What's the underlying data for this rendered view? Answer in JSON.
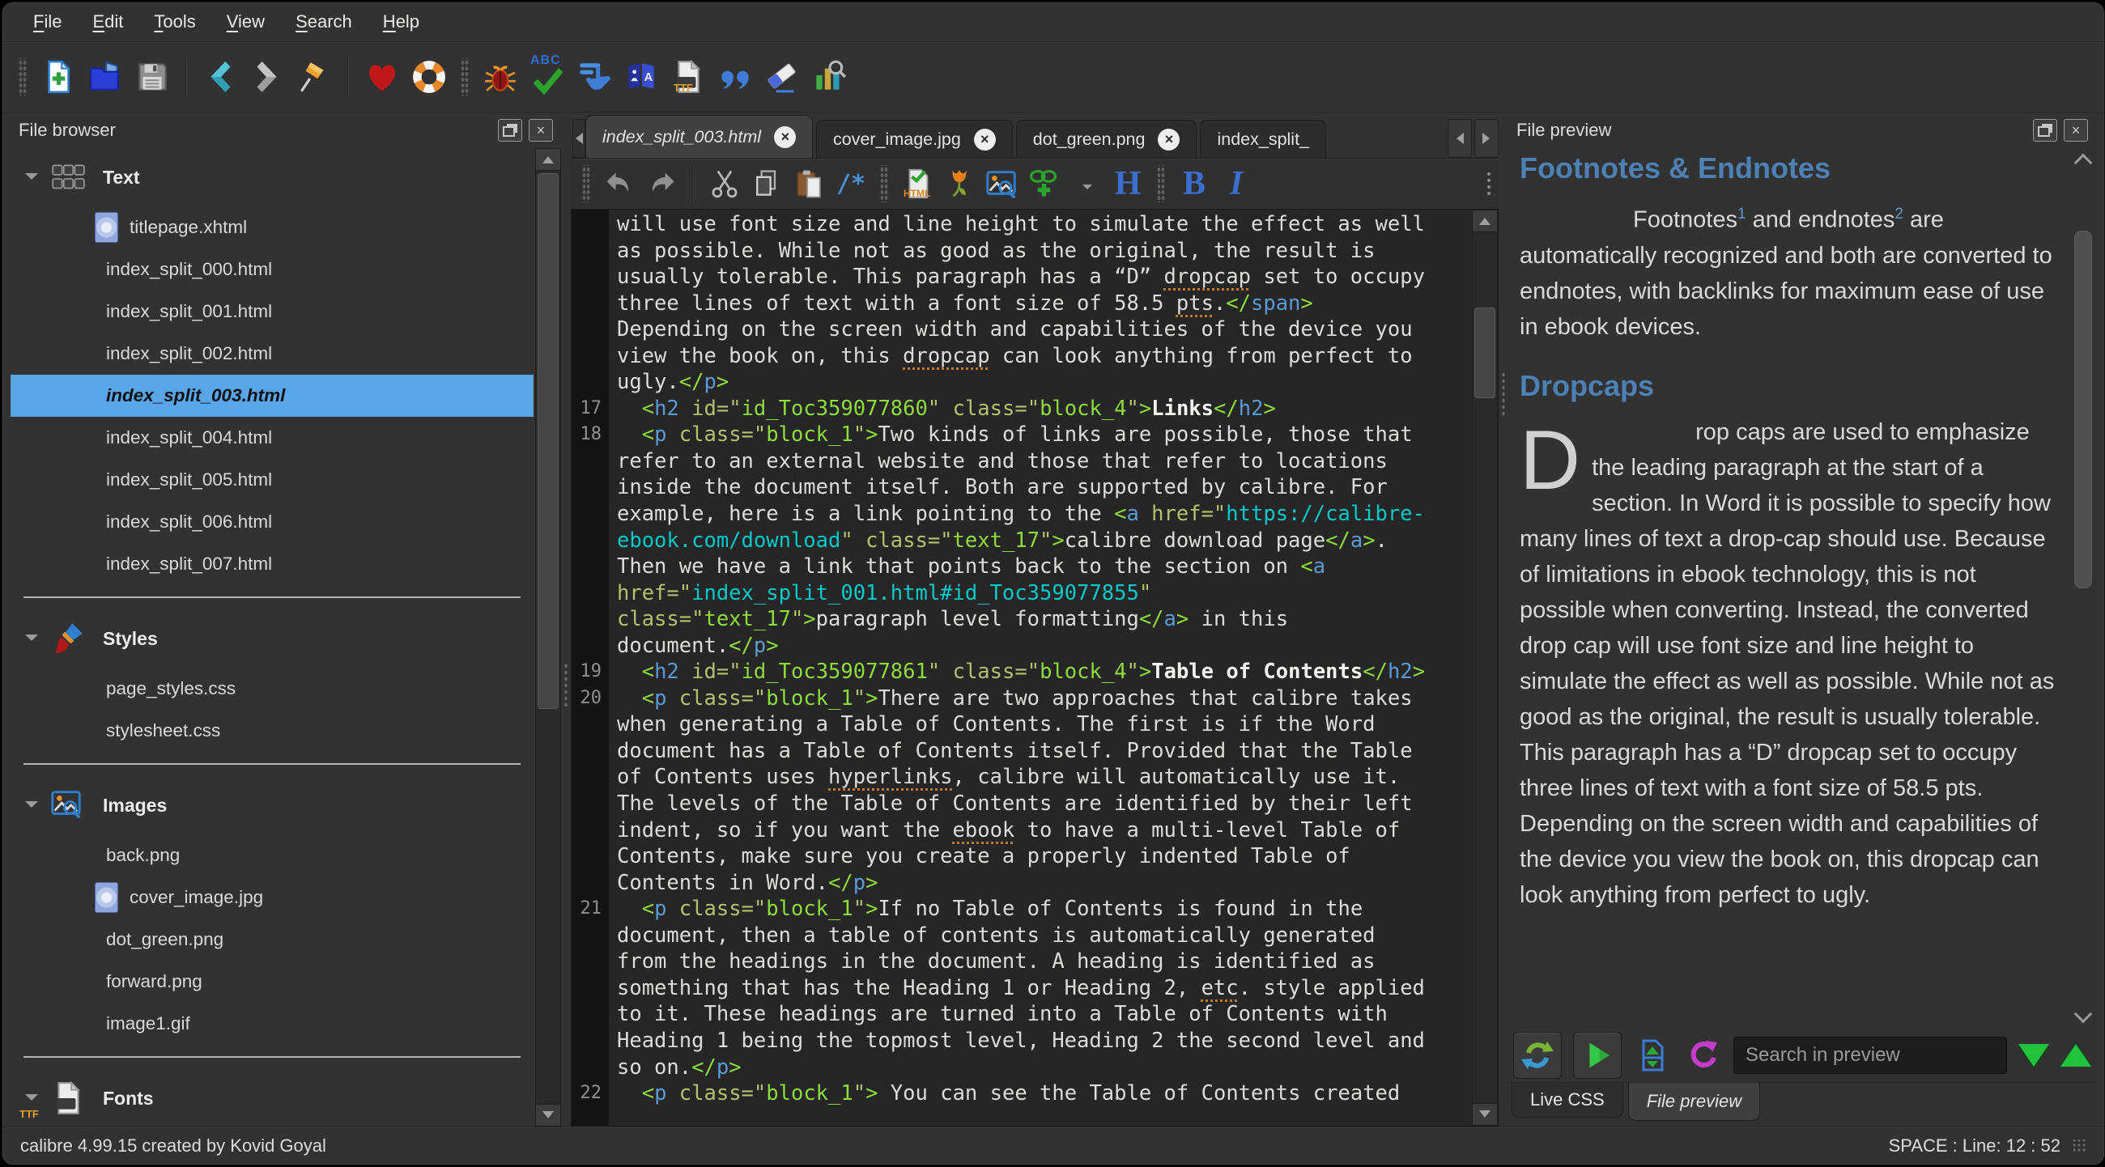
{
  "colors": {
    "selection": "#58a6e8",
    "preview_heading": "#4d80b4",
    "code_green": "#8edb3c",
    "code_blue": "#5b9bd5",
    "code_olive": "#b3c16e",
    "code_cyan": "#00c9c9",
    "squiggle_orange": "#c07828",
    "find_green": "#21c23e"
  },
  "menu": {
    "items": [
      "File",
      "Edit",
      "Tools",
      "View",
      "Search",
      "Help"
    ]
  },
  "toolbar": {
    "groups": [
      {
        "lead": "grip",
        "icons": [
          "new-file",
          "open-ebook",
          "save"
        ]
      },
      {
        "lead": "sep",
        "icons": [
          "go-back",
          "go-forward",
          "pin"
        ]
      },
      {
        "lead": "sep",
        "icons": [
          "donate-heart",
          "help-lifebuoy"
        ]
      },
      {
        "lead": "grip",
        "icons": [
          "check-book-bug",
          "spell-check-abc",
          "fix-html-hand",
          "arrange-files-book",
          "embed-fonts-ttf",
          "smarten-punctuation-quotes",
          "remove-unused-css-eraser",
          "reports-chart"
        ]
      }
    ]
  },
  "icon_labels": {
    "abc": "ABC",
    "ttf": "TTF",
    "html": "HTML",
    "comment": "/*",
    "tag": "</>",
    "heading": "H",
    "bold": "B",
    "italic": "I",
    "translate_a": "A"
  },
  "tabs": {
    "items": [
      {
        "label": "index_split_003.html",
        "active": true,
        "truncated": false
      },
      {
        "label": "cover_image.jpg",
        "active": false,
        "truncated": false
      },
      {
        "label": "dot_green.png",
        "active": false,
        "truncated": false
      },
      {
        "label": "index_split_",
        "active": false,
        "truncated": true
      }
    ]
  },
  "editor_toolbar": {
    "groups": [
      {
        "lead": "grip",
        "icons": [
          "undo",
          "redo"
        ]
      },
      {
        "lead": "sep",
        "icons": [
          "cut",
          "copy",
          "paste",
          "insert-comment"
        ]
      },
      {
        "lead": "grip",
        "icons": [
          "beautify-html",
          "insert-special-char-tulip",
          "insert-image",
          "insert-hyperlink",
          "insert-tag",
          "heading-style"
        ]
      },
      {
        "lead": "grip",
        "icons": [
          "bold",
          "italic"
        ]
      }
    ]
  },
  "file_browser": {
    "title": "File browser",
    "selected": "index_split_003.html",
    "sections": [
      {
        "label": "Text",
        "icon": "keyboard",
        "items": [
          {
            "name": "titlepage.xhtml",
            "thumb": true
          },
          {
            "name": "index_split_000.html"
          },
          {
            "name": "index_split_001.html"
          },
          {
            "name": "index_split_002.html"
          },
          {
            "name": "index_split_003.html"
          },
          {
            "name": "index_split_004.html"
          },
          {
            "name": "index_split_005.html"
          },
          {
            "name": "index_split_006.html"
          },
          {
            "name": "index_split_007.html"
          }
        ]
      },
      {
        "label": "Styles",
        "icon": "brush",
        "items": [
          {
            "name": "page_styles.css"
          },
          {
            "name": "stylesheet.css"
          }
        ]
      },
      {
        "label": "Images",
        "icon": "images",
        "items": [
          {
            "name": "back.png"
          },
          {
            "name": "cover_image.jpg",
            "thumb": true
          },
          {
            "name": "dot_green.png"
          },
          {
            "name": "forward.png"
          },
          {
            "name": "image1.gif"
          }
        ]
      },
      {
        "label": "Fonts",
        "icon": "ttf-file",
        "items": []
      }
    ]
  },
  "editor": {
    "lines": [
      {
        "n": "",
        "s": [
          [
            "w",
            "will use font size and line height to simulate the effect as well"
          ]
        ]
      },
      {
        "n": "",
        "s": [
          [
            "w",
            "as possible. While not as good as the original, the result is"
          ]
        ]
      },
      {
        "n": "",
        "s": [
          [
            "w",
            "usually tolerable. This paragraph has a “D” "
          ],
          [
            "m",
            "dropcap"
          ],
          [
            "w",
            " set to occupy"
          ]
        ]
      },
      {
        "n": "",
        "s": [
          [
            "w",
            "three lines of text with a font size of 58.5 "
          ],
          [
            "m",
            "pts"
          ],
          [
            "w",
            "."
          ],
          [
            "g",
            "</"
          ],
          [
            "b",
            "span"
          ],
          [
            "g",
            ">"
          ]
        ]
      },
      {
        "n": "",
        "s": [
          [
            "w",
            "Depending on the screen width and capabilities of the device you"
          ]
        ]
      },
      {
        "n": "",
        "s": [
          [
            "w",
            "view the book on, this "
          ],
          [
            "m",
            "dropcap"
          ],
          [
            "w",
            " can look anything from perfect to"
          ]
        ]
      },
      {
        "n": "",
        "s": [
          [
            "w",
            "ugly."
          ],
          [
            "g",
            "</"
          ],
          [
            "b",
            "p"
          ],
          [
            "g",
            ">"
          ]
        ]
      },
      {
        "n": "17",
        "s": [
          [
            "w",
            "  "
          ],
          [
            "g",
            "<"
          ],
          [
            "b",
            "h2"
          ],
          [
            "w",
            " "
          ],
          [
            "o",
            "id=\""
          ],
          [
            "g",
            "id_Toc359077860"
          ],
          [
            "o",
            "\""
          ],
          [
            "w",
            " "
          ],
          [
            "o",
            "class=\""
          ],
          [
            "g",
            "block_4"
          ],
          [
            "o",
            "\""
          ],
          [
            "g",
            ">"
          ],
          [
            "wb",
            "Links"
          ],
          [
            "g",
            "</"
          ],
          [
            "b",
            "h2"
          ],
          [
            "g",
            ">"
          ]
        ]
      },
      {
        "n": "18",
        "s": [
          [
            "w",
            "  "
          ],
          [
            "g",
            "<"
          ],
          [
            "b",
            "p"
          ],
          [
            "w",
            " "
          ],
          [
            "o",
            "class=\""
          ],
          [
            "g",
            "block_1"
          ],
          [
            "o",
            "\""
          ],
          [
            "g",
            ">"
          ],
          [
            "w",
            "Two kinds of links are possible, those that"
          ]
        ]
      },
      {
        "n": "",
        "s": [
          [
            "w",
            "refer to an external website and those that refer to locations"
          ]
        ]
      },
      {
        "n": "",
        "s": [
          [
            "w",
            "inside the document itself. Both are supported by calibre. For"
          ]
        ]
      },
      {
        "n": "",
        "s": [
          [
            "w",
            "example, here is a link pointing to the "
          ],
          [
            "g",
            "<"
          ],
          [
            "b",
            "a"
          ],
          [
            "w",
            " "
          ],
          [
            "o",
            "href=\""
          ],
          [
            "c",
            "https://calibre-"
          ]
        ]
      },
      {
        "n": "",
        "s": [
          [
            "c",
            "ebook.com/download"
          ],
          [
            "o",
            "\""
          ],
          [
            "w",
            " "
          ],
          [
            "o",
            "class=\""
          ],
          [
            "g",
            "text_17"
          ],
          [
            "o",
            "\""
          ],
          [
            "g",
            ">"
          ],
          [
            "w",
            "calibre download page"
          ],
          [
            "g",
            "</"
          ],
          [
            "b",
            "a"
          ],
          [
            "g",
            ">"
          ],
          [
            "w",
            "."
          ]
        ]
      },
      {
        "n": "",
        "s": [
          [
            "w",
            "Then we have a link that points back to the section on "
          ],
          [
            "g",
            "<"
          ],
          [
            "b",
            "a"
          ]
        ]
      },
      {
        "n": "",
        "s": [
          [
            "o",
            "href=\""
          ],
          [
            "c",
            "index_split_001.html#id_Toc359077855"
          ],
          [
            "o",
            "\""
          ]
        ]
      },
      {
        "n": "",
        "s": [
          [
            "o",
            "class=\""
          ],
          [
            "g",
            "text_17"
          ],
          [
            "o",
            "\""
          ],
          [
            "g",
            ">"
          ],
          [
            "w",
            "paragraph level formatting"
          ],
          [
            "g",
            "</"
          ],
          [
            "b",
            "a"
          ],
          [
            "g",
            ">"
          ],
          [
            "w",
            " in this"
          ]
        ]
      },
      {
        "n": "",
        "s": [
          [
            "w",
            "document."
          ],
          [
            "g",
            "</"
          ],
          [
            "b",
            "p"
          ],
          [
            "g",
            ">"
          ]
        ]
      },
      {
        "n": "19",
        "s": [
          [
            "w",
            "  "
          ],
          [
            "g",
            "<"
          ],
          [
            "b",
            "h2"
          ],
          [
            "w",
            " "
          ],
          [
            "o",
            "id=\""
          ],
          [
            "g",
            "id_Toc359077861"
          ],
          [
            "o",
            "\""
          ],
          [
            "w",
            " "
          ],
          [
            "o",
            "class=\""
          ],
          [
            "g",
            "block_4"
          ],
          [
            "o",
            "\""
          ],
          [
            "g",
            ">"
          ],
          [
            "wb",
            "Table of Contents"
          ],
          [
            "g",
            "</"
          ],
          [
            "b",
            "h2"
          ],
          [
            "g",
            ">"
          ]
        ]
      },
      {
        "n": "20",
        "s": [
          [
            "w",
            "  "
          ],
          [
            "g",
            "<"
          ],
          [
            "b",
            "p"
          ],
          [
            "w",
            " "
          ],
          [
            "o",
            "class=\""
          ],
          [
            "g",
            "block_1"
          ],
          [
            "o",
            "\""
          ],
          [
            "g",
            ">"
          ],
          [
            "w",
            "There are two approaches that calibre takes"
          ]
        ]
      },
      {
        "n": "",
        "s": [
          [
            "w",
            "when generating a Table of Contents. The first is if the Word"
          ]
        ]
      },
      {
        "n": "",
        "s": [
          [
            "w",
            "document has a Table of Contents itself. Provided that the Table"
          ]
        ]
      },
      {
        "n": "",
        "s": [
          [
            "w",
            "of Contents uses "
          ],
          [
            "m",
            "hyperlinks"
          ],
          [
            "w",
            ", calibre will automatically use it."
          ]
        ]
      },
      {
        "n": "",
        "s": [
          [
            "w",
            "The levels of the Table of Contents are identified by their left"
          ]
        ]
      },
      {
        "n": "",
        "s": [
          [
            "w",
            "indent, so if you want the "
          ],
          [
            "m",
            "ebook"
          ],
          [
            "w",
            " to have a multi-level Table of"
          ]
        ]
      },
      {
        "n": "",
        "s": [
          [
            "w",
            "Contents, make sure you create a properly indented Table of"
          ]
        ]
      },
      {
        "n": "",
        "s": [
          [
            "w",
            "Contents in Word."
          ],
          [
            "g",
            "</"
          ],
          [
            "b",
            "p"
          ],
          [
            "g",
            ">"
          ]
        ]
      },
      {
        "n": "21",
        "s": [
          [
            "w",
            "  "
          ],
          [
            "g",
            "<"
          ],
          [
            "b",
            "p"
          ],
          [
            "w",
            " "
          ],
          [
            "o",
            "class=\""
          ],
          [
            "g",
            "block_1"
          ],
          [
            "o",
            "\""
          ],
          [
            "g",
            ">"
          ],
          [
            "w",
            "If no Table of Contents is found in the"
          ]
        ]
      },
      {
        "n": "",
        "s": [
          [
            "w",
            "document, then a table of contents is automatically generated"
          ]
        ]
      },
      {
        "n": "",
        "s": [
          [
            "w",
            "from the headings in the document. A heading is identified as"
          ]
        ]
      },
      {
        "n": "",
        "s": [
          [
            "w",
            "something that has the Heading 1 or Heading 2, "
          ],
          [
            "m",
            "etc"
          ],
          [
            "w",
            ". style applied"
          ]
        ]
      },
      {
        "n": "",
        "s": [
          [
            "w",
            "to it. These headings are turned into a Table of Contents with"
          ]
        ]
      },
      {
        "n": "",
        "s": [
          [
            "w",
            "Heading 1 being the topmost level, Heading 2 the second level and"
          ]
        ]
      },
      {
        "n": "",
        "s": [
          [
            "w",
            "so on."
          ],
          [
            "g",
            "</"
          ],
          [
            "b",
            "p"
          ],
          [
            "g",
            ">"
          ]
        ]
      },
      {
        "n": "22",
        "s": [
          [
            "w",
            "  "
          ],
          [
            "g",
            "<"
          ],
          [
            "b",
            "p"
          ],
          [
            "w",
            " "
          ],
          [
            "o",
            "class=\""
          ],
          [
            "g",
            "block_1"
          ],
          [
            "o",
            "\""
          ],
          [
            "g",
            ">"
          ],
          [
            "w",
            " You can see the Table of Contents created"
          ]
        ]
      }
    ]
  },
  "preview": {
    "title": "File preview",
    "heading1": "Footnotes & Endnotes",
    "para1": {
      "t1": "Footnotes",
      "sup1": "1",
      "t2": " and endnotes",
      "sup2": "2",
      "t3": " are automatically recognized and both are converted to endnotes, with backlinks for maximum ease of use in ebook devices."
    },
    "heading2": "Dropcaps",
    "dropcap": "D",
    "para2": "rop caps are used to emphasize the leading paragraph at the start of a section. In Word it is possible to specify how many lines of text a drop-cap should use. Because of limitations in ebook technology, this is not possible when converting.  Instead, the converted drop cap will use font size and line height to simulate the effect as well as possible. While not as good as the original, the result is usually tolerable. This paragraph has a “D” dropcap set to occupy three lines of text with a font size of 58.5 pts. Depending on the screen width and capabilities of the device you view the book on, this dropcap can look anything from perfect to ugly.",
    "search_placeholder": "Search in preview",
    "bottom_tabs": [
      {
        "label": "Live CSS",
        "active": false
      },
      {
        "label": "File preview",
        "active": true
      }
    ]
  },
  "statusbar": {
    "left": "calibre 4.99.15 created by Kovid Goyal",
    "right": "SPACE : Line: 12 : 52"
  }
}
